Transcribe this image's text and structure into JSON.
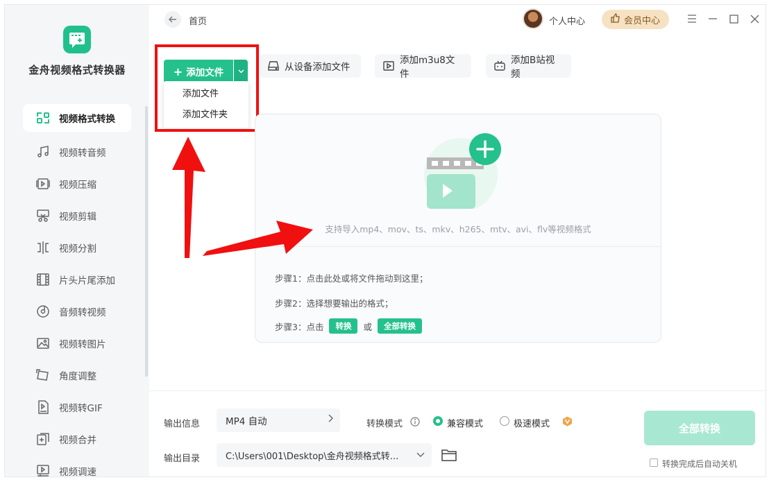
{
  "app": {
    "name": "金舟视频格式转换器"
  },
  "topbar": {
    "breadcrumb": "首页",
    "user_center": "个人中心",
    "vip_center": "会员中心"
  },
  "sidebar": {
    "items": [
      {
        "label": "视频格式转换",
        "icon": "convert-icon",
        "active": true
      },
      {
        "label": "视频转音频",
        "icon": "music-note-icon"
      },
      {
        "label": "视频压缩",
        "icon": "compress-icon"
      },
      {
        "label": "视频剪辑",
        "icon": "scissors-icon"
      },
      {
        "label": "视频分割",
        "icon": "split-icon"
      },
      {
        "label": "片头片尾添加",
        "icon": "film-strip-icon"
      },
      {
        "label": "音频转视频",
        "icon": "disc-icon"
      },
      {
        "label": "视频转图片",
        "icon": "image-icon"
      },
      {
        "label": "角度调整",
        "icon": "rotate-icon"
      },
      {
        "label": "视频转GIF",
        "icon": "gif-icon"
      },
      {
        "label": "视频合并",
        "icon": "merge-icon"
      },
      {
        "label": "视频调速",
        "icon": "speed-icon"
      }
    ]
  },
  "toolbar": {
    "add_file": "添加文件",
    "dropdown": [
      "添加文件",
      "添加文件夹"
    ],
    "add_from_device": "从设备添加文件",
    "add_m3u8": "添加m3u8文件",
    "add_bilibili": "添加B站视频"
  },
  "dropzone": {
    "hint": "支持导入mp4、mov、ts、mkv、h265、mtv、avi、flv等视频格式",
    "step1": "步骤1：点击此处或将文件拖动到这里；",
    "step2": "步骤2：选择想要输出的格式；",
    "step3_prefix": "步骤3：点击",
    "step3_btn1": "转换",
    "step3_mid": "或",
    "step3_btn2": "全部转换"
  },
  "output": {
    "info_label": "输出信息",
    "format_value": "MP4 自动",
    "mode_label": "转换模式",
    "mode_compatible": "兼容模式",
    "mode_fast": "极速模式",
    "dir_label": "输出目录",
    "dir_value": "C:\\Users\\001\\Desktop\\金舟视频格式转...",
    "convert_all": "全部转换",
    "auto_shutdown": "转换完成后自动关机"
  },
  "colors": {
    "accent": "#24c18d",
    "annotation_red": "#f01010",
    "vip_bg": "#f6e2c3"
  }
}
